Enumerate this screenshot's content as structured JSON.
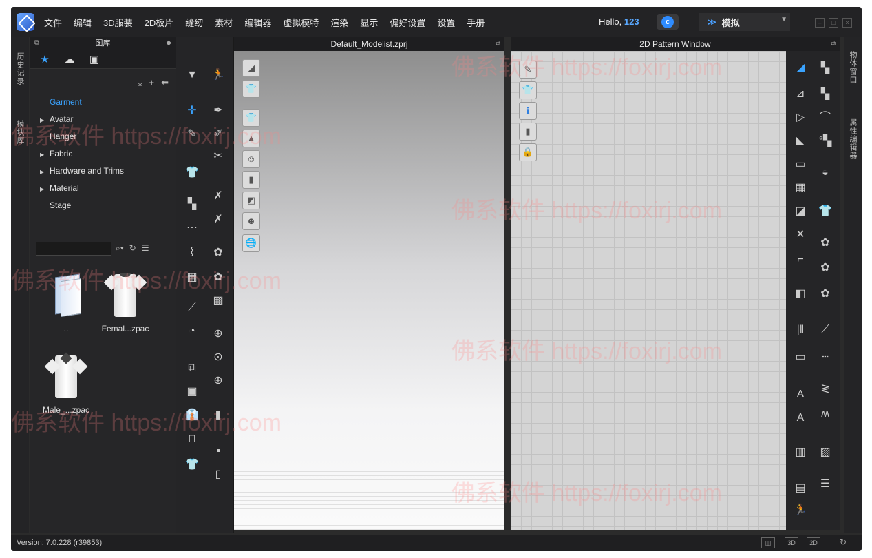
{
  "menu": [
    "文件",
    "编辑",
    "3D服装",
    "2D板片",
    "缝纫",
    "素材",
    "编辑器",
    "虚拟模特",
    "渲染",
    "显示",
    "偏好设置",
    "设置",
    "手册"
  ],
  "user": {
    "greeting": "Hello, ",
    "name": "123"
  },
  "mode": {
    "label": "模拟"
  },
  "side_left": {
    "history": "历史记录",
    "modular": "模块库"
  },
  "side_right": {
    "object": "物体窗口",
    "property": "属性编辑器"
  },
  "library": {
    "title": "图库",
    "tree": [
      {
        "label": "Garment",
        "selected": true,
        "expandable": false
      },
      {
        "label": "Avatar",
        "selected": false,
        "expandable": true
      },
      {
        "label": "Hanger",
        "selected": false,
        "expandable": false
      },
      {
        "label": "Fabric",
        "selected": false,
        "expandable": true
      },
      {
        "label": "Hardware and Trims",
        "selected": false,
        "expandable": true
      },
      {
        "label": "Material",
        "selected": false,
        "expandable": true
      },
      {
        "label": "Stage",
        "selected": false,
        "expandable": false
      }
    ],
    "files": [
      {
        "label": ".."
      },
      {
        "label": "Femal...zpac"
      },
      {
        "label": "Male_...zpac"
      }
    ]
  },
  "viewport3d": {
    "title": "Default_Modelist.zprj"
  },
  "viewport2d": {
    "title": "2D Pattern Window"
  },
  "status": {
    "version": "Version: 7.0.228 (r39853)",
    "btn3d": "3D",
    "btn2d": "2D"
  },
  "watermark": "佛系软件 https://foxirj.com",
  "colors": {
    "accent": "#3aa3ff",
    "menubar": "#232325",
    "panel": "#262628"
  }
}
